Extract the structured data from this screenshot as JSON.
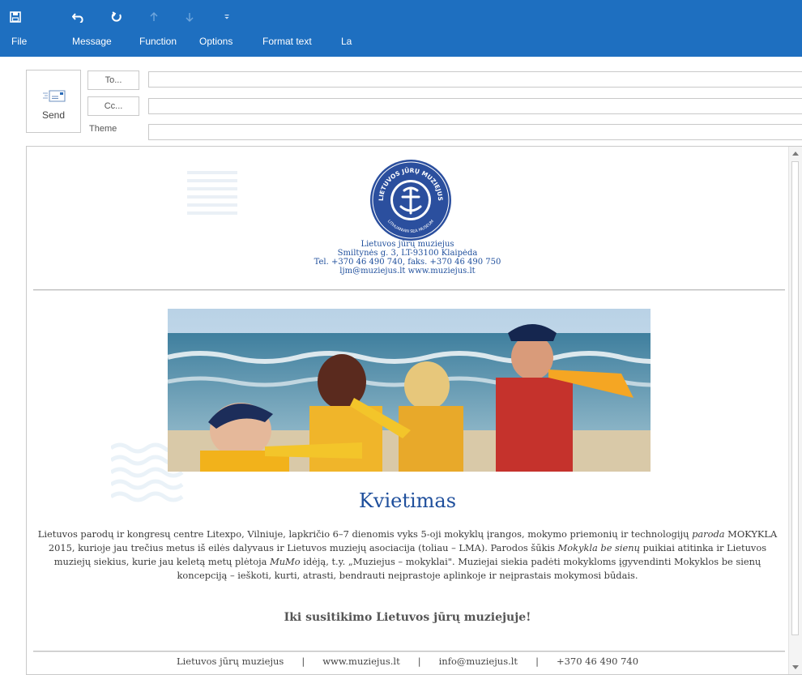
{
  "ribbon": {
    "quick_access": [
      {
        "icon": "save-icon"
      },
      {
        "icon": "undo-icon"
      },
      {
        "icon": "redo-icon"
      },
      {
        "icon": "arrow-up-icon"
      },
      {
        "icon": "arrow-down-icon"
      },
      {
        "icon": "customize-dropdown-icon"
      }
    ],
    "menu": [
      "File",
      "Message",
      "Function",
      "Options",
      "Format text",
      "La"
    ]
  },
  "compose": {
    "send_label": "Send",
    "to_label": "To...",
    "cc_label": "Cc...",
    "theme_label": "Theme",
    "to_value": "",
    "cc_value": "",
    "theme_value": ""
  },
  "email": {
    "logo": {
      "top_text": "LIETUVOS JŪRŲ MUZIEJUS",
      "bottom_text": "LITHUANIAN SEA MUSEUM"
    },
    "museum_name": "Lietuvos jūrų muziejus",
    "address": "Smiltynės g. 3, LT-93100 Klaipėda",
    "phone": "Tel. +370 46 490 740, faks. +370 46 490 750",
    "contacts": "ljm@muziejus.lt www.muziejus.lt",
    "title": "Kvietimas",
    "paragraph": {
      "p1": "Lietuvos parodų ir kongresų centre Litexpo, Vilniuje, lapkričio 6–7 dienomis vyks 5-oji mokyklų įrangos, mokymo priemonių ir technologijų ",
      "p2": "paroda",
      "p3": " MOKYKLA 2015, kurioje jau trečius metus iš eilės dalyvaus ir Lietuvos muziejų asociacija (toliau – LMA). Parodos šūkis ",
      "p4": "Mokykla be sienų",
      "p5": " puikiai atitinka ir Lietuvos muziejų siekius, kurie jau keletą metų plėtoja ",
      "p6": "MuMo",
      "p7": " idėją, t.y. „Muziejus – mokyklai\". Muziejai siekia padėti mokykloms įgyvendinti Mokyklos be sienų koncepciją – ieškoti, kurti, atrasti, bendrauti neįprastoje aplinkoje ir neįprastais mokymosi būdais."
    },
    "closing": "Iki susitikimo Lietuvos jūrų muziejuje!",
    "footer": {
      "name": "Lietuvos jūrų muziejus",
      "web": "www.muziejus.lt",
      "email": "info@muziejus.lt",
      "phone": "+370 46 490 740"
    }
  },
  "colors": {
    "ribbon": "#1e6fc0",
    "brand_blue": "#1f4f9c"
  }
}
